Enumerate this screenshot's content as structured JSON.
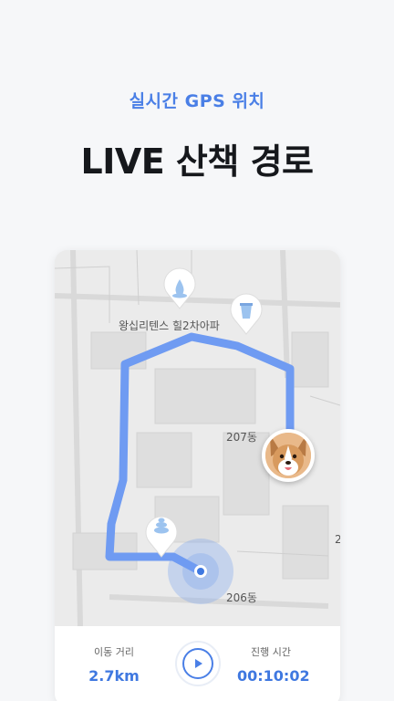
{
  "header": {
    "subtitle": "실시간 GPS 위치",
    "headline": "LIVE 산책 경로"
  },
  "map": {
    "building_name": "왕십리텐스 힐2차아파",
    "building_207": "207동",
    "building_206": "206동",
    "edge_label": "2",
    "route_color": "#6f9bf2",
    "markers": [
      "water-drop-icon",
      "water-cup-icon",
      "poop-icon"
    ],
    "current_location": "location-dot-icon"
  },
  "stats": {
    "distance_label": "이동 거리",
    "distance_value": "2.7km",
    "time_label": "진행 시간",
    "time_value": "00:10:02"
  },
  "colors": {
    "accent": "#4a7fe6",
    "headline": "#16181c",
    "background": "#f6f7f9"
  }
}
